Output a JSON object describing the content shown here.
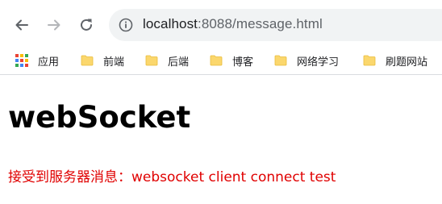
{
  "browser": {
    "url_host": "localhost",
    "url_path": ":8088/message.html",
    "bookmarks": [
      {
        "label": "应用",
        "icon": "apps-grid-icon"
      },
      {
        "label": "前端",
        "icon": "folder-icon"
      },
      {
        "label": "后端",
        "icon": "folder-icon"
      },
      {
        "label": "博客",
        "icon": "folder-icon"
      },
      {
        "label": "网络学习",
        "icon": "folder-icon"
      },
      {
        "label": "刷题网站",
        "icon": "folder-icon"
      }
    ],
    "folder_color": "#fbd76d",
    "apps_colors": [
      "#ea4335",
      "#fbbc05",
      "#34a853",
      "#4285f4",
      "#ea4335",
      "#fbbc05",
      "#34a853",
      "#4285f4",
      "#ea4335"
    ]
  },
  "page": {
    "title": "webSocket",
    "message": "接受到服务器消息：websocket client connect test",
    "message_color": "#e00000"
  }
}
